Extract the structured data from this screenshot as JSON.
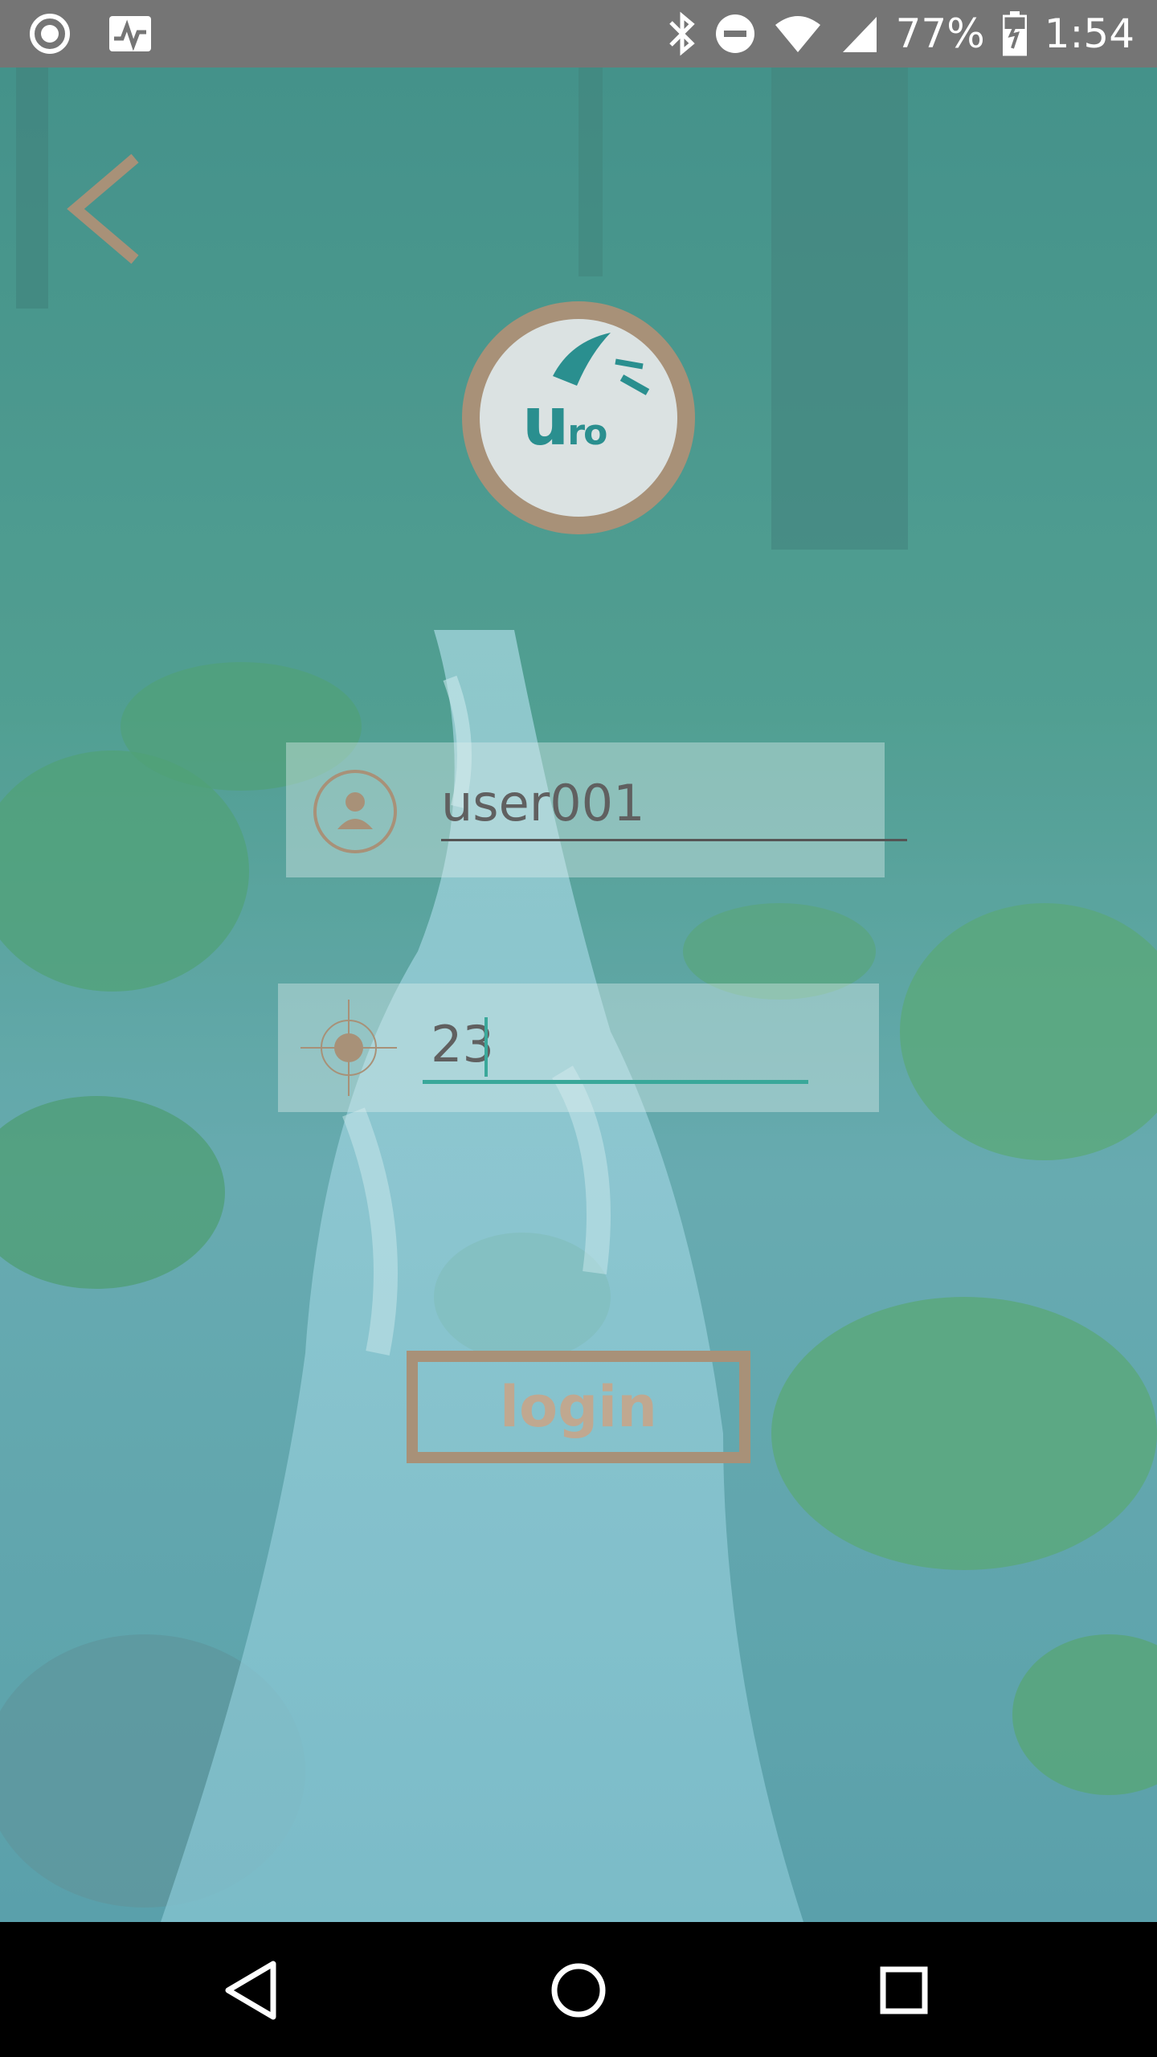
{
  "status_bar": {
    "battery": "77%",
    "time": "1:54",
    "icons": [
      "record-icon",
      "pulse-icon",
      "bluetooth-icon",
      "do-not-disturb-icon",
      "wifi-icon",
      "signal-icon",
      "battery-icon"
    ]
  },
  "header": {
    "back_icon": "chevron-left-icon"
  },
  "logo": {
    "text_big": "u",
    "text_small": "ro"
  },
  "form": {
    "username": {
      "icon": "user-icon",
      "value": "user001"
    },
    "code": {
      "icon": "crosshair-icon",
      "value": "23"
    },
    "login_label": "login"
  },
  "nav_bar": {
    "icons": [
      "back-icon",
      "home-icon",
      "recent-apps-icon"
    ]
  },
  "colors": {
    "status_bar": "#757575",
    "accent_brown": "#a89178",
    "accent_teal": "#3aa89a",
    "overlay_teal": "#5fb8c0"
  }
}
